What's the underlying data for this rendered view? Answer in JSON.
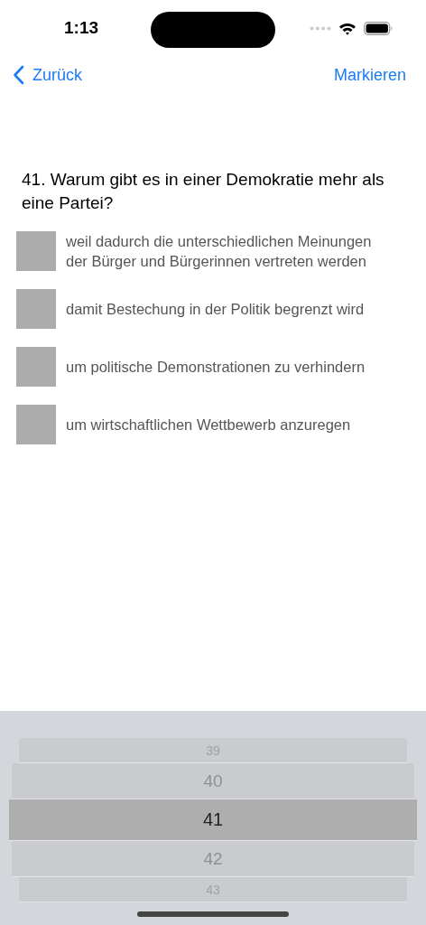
{
  "status_bar": {
    "time": "1:13"
  },
  "nav": {
    "back": "Zurück",
    "action": "Markieren"
  },
  "question": "41. Warum gibt es in einer Demokratie mehr als eine Partei?",
  "answers": [
    {
      "text": "weil dadurch die unterschiedlichen Meinungen der Bürger und Bürgerinnen vertreten werden",
      "checked": false
    },
    {
      "text": "damit Bestechung in der Politik begrenzt wird",
      "checked": false
    },
    {
      "text": "um politische Demonstrationen zu verhindern",
      "checked": false
    },
    {
      "text": "um wirtschaftlichen Wettbewerb anzuregen",
      "checked": false
    }
  ],
  "picker": [
    {
      "label": "39",
      "selected": false
    },
    {
      "label": "40",
      "selected": false
    },
    {
      "label": "41",
      "selected": true
    },
    {
      "label": "42",
      "selected": false
    },
    {
      "label": "43",
      "selected": false
    }
  ]
}
